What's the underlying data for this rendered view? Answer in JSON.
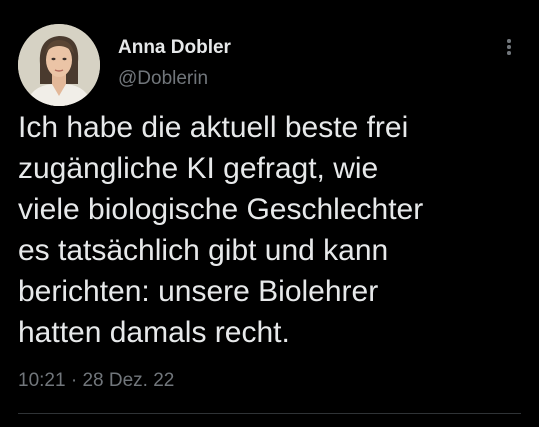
{
  "tweet": {
    "author": {
      "name": "Anna Dobler",
      "handle": "@Doblerin"
    },
    "text": "Ich habe die aktuell beste frei\nzugängliche KI gefragt, wie\nviele biologische Geschlechter\nes tatsächlich gibt und kann\nberichten: unsere Biolehrer\nhatten damals recht.",
    "time": "10:21",
    "separator": "·",
    "date": "28 Dez. 22"
  },
  "icons": {
    "more": "more-options-icon"
  },
  "colors": {
    "background": "#000000",
    "primary_text": "#e7e9ea",
    "secondary_text": "#71767b",
    "divider": "#2f3336"
  }
}
